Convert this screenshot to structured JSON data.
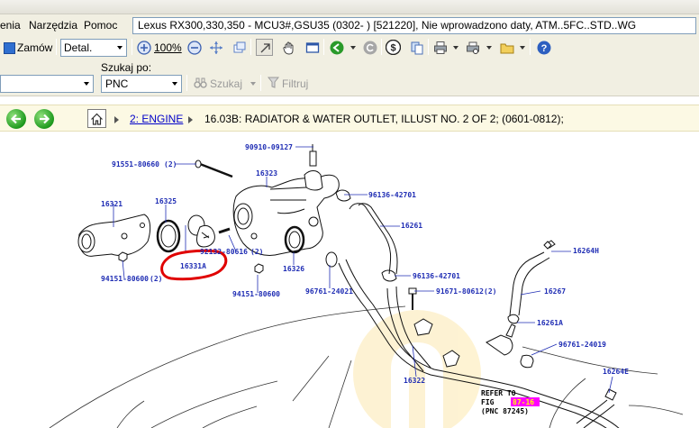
{
  "menu": {
    "items": [
      {
        "label": "enia"
      },
      {
        "label": "Narzędzia"
      },
      {
        "label": "Pomoc"
      }
    ]
  },
  "vehicle": {
    "title": "Lexus RX300,330,350 - MCU3#,GSU35 (0302-   ) [521220], Nie wprowadzono daty,  ATM..5FC..STD..WG"
  },
  "toolbar": {
    "order_label": "Zamów",
    "detail_value": "Detal.",
    "zoom_value": "100%"
  },
  "search": {
    "label": "Szukaj po:",
    "field_value": "PNC",
    "search_label": "Szukaj",
    "filter_label": "Filtruj"
  },
  "breadcrumb": {
    "section": "2: ENGINE",
    "current": "16.03B: RADIATOR & WATER OUTLET, ILLUST NO. 2 OF 2;  (0601-0812);"
  },
  "diagram": {
    "labels": {
      "p90910": "90910-09127",
      "p91551": "91551-80660",
      "p91551q": "(2)",
      "p16323": "16323",
      "p96136a": "96136-42701",
      "p16321": "16321",
      "p16325": "16325",
      "p16261": "16261",
      "p92132": "92132-80616",
      "p92132q": "(2)",
      "p16331a": "16331A",
      "p16326": "16326",
      "p16264h": "16264H",
      "p94151a": "94151-80600",
      "p94151aq": "(2)",
      "p96136b": "96136-42701",
      "p96761a": "96761-24021",
      "p91671": "91671-80612",
      "p91671q": "(2)",
      "p16267": "16267",
      "p94151b": "94151-80600",
      "p16261a": "16261A",
      "p96761b": "96761-24019",
      "p16322": "16322",
      "p16264e": "16264E",
      "refer1": "REFER TO",
      "refer2_prefix": "FIG ",
      "refer2_fig": "87-16",
      "refer3": "(PNC 87245)"
    },
    "highlight_color": "#ff00ff",
    "circle_color": "#e00000",
    "label_color": "#1f2db4"
  }
}
